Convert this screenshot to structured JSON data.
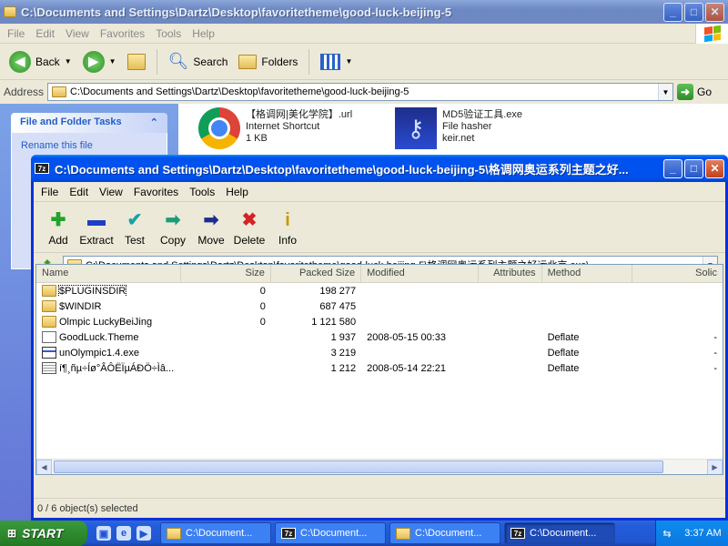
{
  "explorer": {
    "title": "C:\\Documents and Settings\\Dartz\\Desktop\\favoritetheme\\good-luck-beijing-5",
    "menu": [
      "File",
      "Edit",
      "View",
      "Favorites",
      "Tools",
      "Help"
    ],
    "toolbar": {
      "back": "Back",
      "search": "Search",
      "folders": "Folders"
    },
    "address_label": "Address",
    "address": "C:\\Documents and Settings\\Dartz\\Desktop\\favoritetheme\\good-luck-beijing-5",
    "go": "Go",
    "tasks": {
      "file_folder_title": "File and Folder Tasks",
      "rename": "Rename this file"
    },
    "files": [
      {
        "name": "【格调网|美化学院】.url",
        "type": "Internet Shortcut",
        "meta": "1 KB",
        "icon": "chrome-icon"
      },
      {
        "name": "MD5验证工具.exe",
        "type": "File hasher",
        "meta": "keir.net",
        "icon": "key-icon"
      }
    ]
  },
  "zip": {
    "title": "C:\\Documents and Settings\\Dartz\\Desktop\\favoritetheme\\good-luck-beijing-5\\格调网奥运系列主题之好...",
    "menu": [
      "File",
      "Edit",
      "View",
      "Favorites",
      "Tools",
      "Help"
    ],
    "tools": [
      {
        "label": "Add",
        "symbol": "✚",
        "color": "#22a32a",
        "icon": "add-icon"
      },
      {
        "label": "Extract",
        "symbol": "▬",
        "color": "#1d3fc7",
        "icon": "extract-icon"
      },
      {
        "label": "Test",
        "symbol": "✔",
        "color": "#1aa3a3",
        "icon": "test-icon"
      },
      {
        "label": "Copy",
        "symbol": "➡",
        "color": "#1a9c7a",
        "icon": "copy-icon"
      },
      {
        "label": "Move",
        "symbol": "➡",
        "color": "#1b2d8f",
        "icon": "move-icon"
      },
      {
        "label": "Delete",
        "symbol": "✖",
        "color": "#d42323",
        "icon": "delete-icon"
      },
      {
        "label": "Info",
        "symbol": "i",
        "color": "#c79a00",
        "icon": "info-icon"
      }
    ],
    "path": "C:\\Documents and Settings\\Dartz\\Desktop\\favoritetheme\\good-luck-beijing-5\\格调网奥运系列主题之好运北京.exe\\",
    "columns": [
      "Name",
      "Size",
      "Packed Size",
      "Modified",
      "Attributes",
      "Method",
      "Solic"
    ],
    "rows": [
      {
        "name": "$PLUGINSDIR",
        "size": "0",
        "packed": "198 277",
        "modified": "",
        "attributes": "",
        "method": "",
        "solid": "",
        "icon": "folder"
      },
      {
        "name": "$WINDIR",
        "size": "0",
        "packed": "687 475",
        "modified": "",
        "attributes": "",
        "method": "",
        "solid": "",
        "icon": "folder"
      },
      {
        "name": "Olmpic LuckyBeiJing",
        "size": "0",
        "packed": "1 121 580",
        "modified": "",
        "attributes": "",
        "method": "",
        "solid": "",
        "icon": "folder"
      },
      {
        "name": "GoodLuck.Theme",
        "size": "",
        "packed": "1 937",
        "modified": "2008-05-15 00:33",
        "attributes": "",
        "method": "Deflate",
        "solid": "-",
        "icon": "doc"
      },
      {
        "name": "unOlympic1.4.exe",
        "size": "",
        "packed": "3 219",
        "modified": "",
        "attributes": "",
        "method": "Deflate",
        "solid": "-",
        "icon": "exe"
      },
      {
        "name": "í¶¸ñµ÷Íø°ÂÔËÏµÁÐÖ÷Ìâ...",
        "size": "",
        "packed": "1 212",
        "modified": "2008-05-14 22:21",
        "attributes": "",
        "method": "Deflate",
        "solid": "-",
        "icon": "txt"
      }
    ],
    "status": "0 / 6 object(s) selected"
  },
  "taskbar": {
    "start": "START",
    "buttons": [
      {
        "label": "C:\\Document...",
        "icon": "folder",
        "active": false
      },
      {
        "label": "C:\\Document...",
        "icon": "7z",
        "active": false
      },
      {
        "label": "C:\\Document...",
        "icon": "folder",
        "active": false
      },
      {
        "label": "C:\\Document...",
        "icon": "7z",
        "active": true
      }
    ],
    "clock": "3:37 AM"
  }
}
